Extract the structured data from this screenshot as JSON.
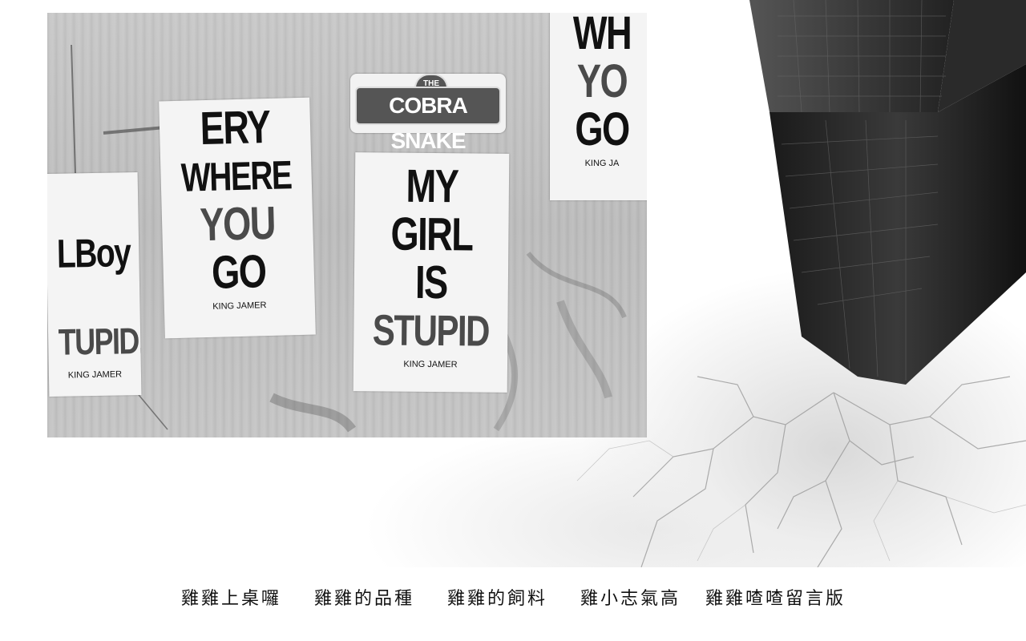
{
  "photo": {
    "sign": {
      "the": "THE",
      "name": "COBRA SNAKE"
    },
    "posters": [
      {
        "lines": [
          "LBoy",
          "TUPID."
        ],
        "credit": "KING JAMER"
      },
      {
        "lines": [
          "ERY",
          "WHERE",
          "YOU",
          "GO"
        ],
        "credit": "KING JAMER"
      },
      {
        "lines": [
          "MY",
          "GIRL",
          "IS",
          "STUPID"
        ],
        "credit": "KING JAMER"
      },
      {
        "lines": [
          "WH",
          "YO",
          "GO"
        ],
        "credit": "KING JA"
      }
    ]
  },
  "nav": {
    "items": [
      {
        "label": "雞雞上桌囉"
      },
      {
        "label": "雞雞的品種"
      },
      {
        "label": "雞雞的飼料"
      },
      {
        "label": "雞小志氣高"
      },
      {
        "label": "雞雞喳喳留言版"
      }
    ]
  }
}
